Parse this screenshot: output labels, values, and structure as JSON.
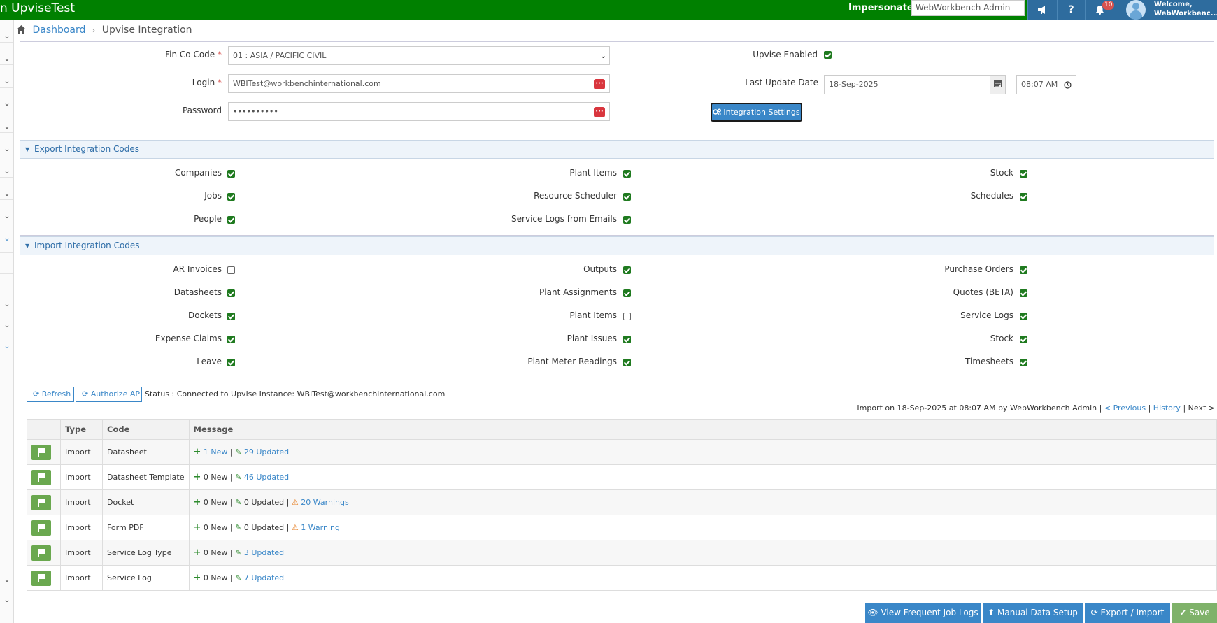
{
  "topbar": {
    "title": "n UpviseTest",
    "impersonate_label": "Impersonate To",
    "impersonate_value": "WebWorkbench Admin",
    "notifications_count": "10",
    "welcome_line1": "Welcome,",
    "welcome_line2": "WebWorkbenc...",
    "icons": [
      "megaphone-icon",
      "help-icon",
      "bell-icon",
      "user-avatar"
    ]
  },
  "breadcrumb": {
    "home_label": "Dashboard",
    "current": "Upvise Integration"
  },
  "settings": {
    "fin_co_code_label": "Fin Co Code",
    "fin_co_code_value": "01 : ASIA / PACIFIC CIVIL",
    "login_label": "Login",
    "login_value": "WBITest@workbenchinternational.com",
    "password_label": "Password",
    "password_value": "••••••••••",
    "upvise_enabled_label": "Upvise Enabled",
    "upvise_enabled": true,
    "last_update_label": "Last Update Date",
    "last_update_date": "18-Sep-2025",
    "last_update_time": "08:07 AM",
    "integration_settings_label": "Integration Settings",
    "required_mark": "*"
  },
  "export_section": {
    "title": "Export Integration Codes",
    "col1": [
      {
        "label": "Companies",
        "checked": true
      },
      {
        "label": "Jobs",
        "checked": true
      },
      {
        "label": "People",
        "checked": true
      }
    ],
    "col2": [
      {
        "label": "Plant Items",
        "checked": true
      },
      {
        "label": "Resource Scheduler",
        "checked": true
      },
      {
        "label": "Service Logs from Emails",
        "checked": true
      }
    ],
    "col3": [
      {
        "label": "Stock",
        "checked": true
      },
      {
        "label": "Schedules",
        "checked": true
      }
    ]
  },
  "import_section": {
    "title": "Import Integration Codes",
    "col1": [
      {
        "label": "AR Invoices",
        "checked": false
      },
      {
        "label": "Datasheets",
        "checked": true
      },
      {
        "label": "Dockets",
        "checked": true
      },
      {
        "label": "Expense Claims",
        "checked": true
      },
      {
        "label": "Leave",
        "checked": true
      }
    ],
    "col2": [
      {
        "label": "Outputs",
        "checked": true
      },
      {
        "label": "Plant Assignments",
        "checked": true
      },
      {
        "label": "Plant Items",
        "checked": false
      },
      {
        "label": "Plant Issues",
        "checked": true
      },
      {
        "label": "Plant Meter Readings",
        "checked": true
      }
    ],
    "col3": [
      {
        "label": "Purchase Orders",
        "checked": true
      },
      {
        "label": "Quotes (BETA)",
        "checked": true
      },
      {
        "label": "Service Logs",
        "checked": true
      },
      {
        "label": "Stock",
        "checked": true
      },
      {
        "label": "Timesheets",
        "checked": true
      }
    ]
  },
  "actions": {
    "refresh_label": "Refresh",
    "authorize_label": "Authorize API",
    "status_text": "Status : Connected to Upvise Instance: WBITest@workbenchinternational.com"
  },
  "import_info": {
    "text": "Import on 18-Sep-2025 at 08:07 AM by WebWorkbench Admin",
    "sep": "|",
    "previous_label": "< Previous",
    "history_label": "History",
    "next_label": "Next >"
  },
  "log_table": {
    "headers": [
      "",
      "Type",
      "Code",
      "Message"
    ],
    "rows": [
      {
        "type": "Import",
        "code": "Datasheet",
        "new": "1 New",
        "new_link": true,
        "updated": "29 Updated",
        "updated_link": true,
        "warning": ""
      },
      {
        "type": "Import",
        "code": "Datasheet Template",
        "new": "0 New",
        "new_link": false,
        "updated": "46 Updated",
        "updated_link": true,
        "warning": ""
      },
      {
        "type": "Import",
        "code": "Docket",
        "new": "0 New",
        "new_link": false,
        "updated": "0 Updated",
        "updated_link": false,
        "warning": "20 Warnings"
      },
      {
        "type": "Import",
        "code": "Form PDF",
        "new": "0 New",
        "new_link": false,
        "updated": "0 Updated",
        "updated_link": false,
        "warning": "1 Warning"
      },
      {
        "type": "Import",
        "code": "Service Log Type",
        "new": "0 New",
        "new_link": false,
        "updated": "3 Updated",
        "updated_link": true,
        "warning": ""
      },
      {
        "type": "Import",
        "code": "Service Log",
        "new": "0 New",
        "new_link": false,
        "updated": "7 Updated",
        "updated_link": true,
        "warning": ""
      }
    ]
  },
  "footer_buttons": {
    "view_logs": "View Frequent Job Logs",
    "manual_setup": "Manual Data Setup",
    "export_import": "Export / Import",
    "save": "Save"
  },
  "colors": {
    "topbar": "#008000",
    "accent": "#3a87c8",
    "checkbox": "#1f7a1f",
    "danger": "#d9363e",
    "warning": "#e67e22"
  }
}
